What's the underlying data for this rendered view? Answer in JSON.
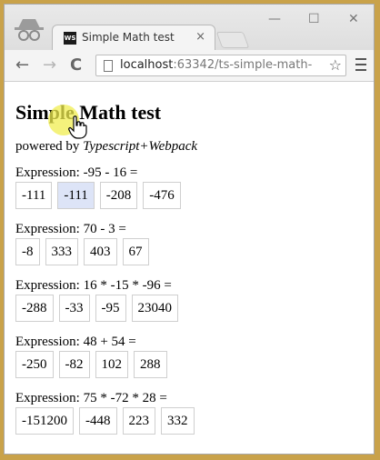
{
  "browser": {
    "tab_title": "Simple Math test",
    "tab_favicon": "WS",
    "close_glyph": "×",
    "url_host": "localhost",
    "url_rest": ":63342/ts-simple-math-",
    "window_controls": [
      "—",
      "☐",
      "✕"
    ],
    "nav": {
      "back": "←",
      "forward": "→",
      "reload": "C",
      "star": "☆"
    }
  },
  "page": {
    "title": "Simple Math test",
    "powered_prefix": "powered by ",
    "powered_tech": "Typescript+Webpack"
  },
  "questions": [
    {
      "expression": "Expression: -95 - 16 =",
      "answers": [
        "-111",
        "-111",
        "-208",
        "-476"
      ]
    },
    {
      "expression": "Expression: 70 - 3 =",
      "answers": [
        "-8",
        "333",
        "403",
        "67"
      ]
    },
    {
      "expression": "Expression: 16 * -15 * -96 =",
      "answers": [
        "-288",
        "-33",
        "-95",
        "23040"
      ]
    },
    {
      "expression": "Expression: 48 + 54 =",
      "answers": [
        "-250",
        "-82",
        "102",
        "288"
      ]
    },
    {
      "expression": "Expression: 75 * -72 * 28 =",
      "answers": [
        "-151200",
        "-448",
        "223",
        "332"
      ]
    }
  ],
  "hovered": {
    "question": 0,
    "answer": 1
  },
  "colors": {
    "hover_bg": "#dde4f7",
    "frame": "#c9a24a",
    "click_highlight": "#f0ee50"
  }
}
